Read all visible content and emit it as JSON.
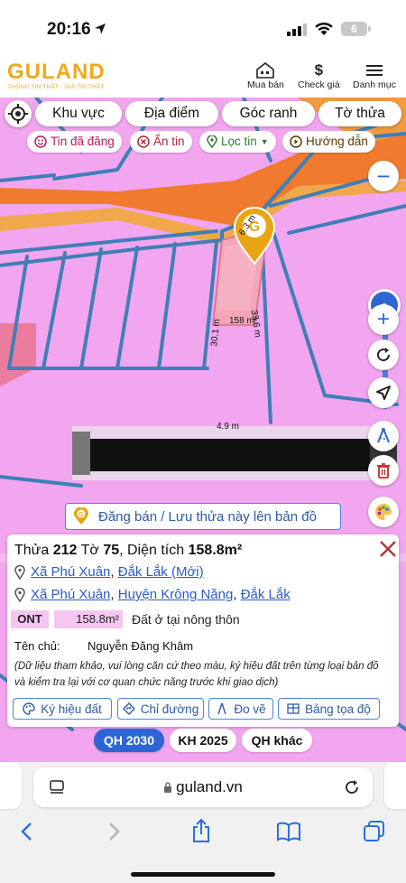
{
  "status": {
    "time": "20:16",
    "battery": "6"
  },
  "header": {
    "logo": "GULAND",
    "tagline": "THÔNG TIN THẬT - GIÁ TRỊ THẬT",
    "buy_sell": "Mua bán",
    "check_price": "Check giá",
    "menu": "Danh mục"
  },
  "top_nav": {
    "region": "Khu vực",
    "place": "Địa điểm",
    "boundary": "Góc ranh",
    "parcel": "Tờ thửa"
  },
  "filters": {
    "posted": "Tin đã đăng",
    "hide": "Ẩn tin",
    "filter": "Lọc tin",
    "guide": "Hướng dẫn"
  },
  "map": {
    "zoom_value": "0",
    "dims": {
      "top": "6.3 m",
      "left": "30.1 m",
      "right": "33.6 m",
      "bottom": "4.9 m",
      "area": "158 m²"
    },
    "post_banner": "Đăng bán / Lưu thửa này lên bản đồ"
  },
  "parcel": {
    "title_prefix": "Thửa",
    "parcel_no": "212",
    "sheet_label": "Tờ",
    "sheet_no": "75",
    "area_label": ", Diện tích",
    "area": "158.8m²",
    "address1": {
      "commune": "Xã Phú Xuân",
      "sep": ",",
      "province": "Đắk Lắk (Mới)"
    },
    "address2": {
      "commune": "Xã Phú Xuân",
      "district": "Huyện Krông Năng",
      "province": "Đắk Lắk"
    },
    "land_code": "ONT",
    "land_area": "158.8m²",
    "land_desc": "Đất ở tại nông thôn",
    "owner_label": "Tên chủ:",
    "owner_name": "Nguyễn Đăng Khâm",
    "note": "(Dữ liệu tham khảo, vui lòng căn cứ theo màu, ký hiệu đất trên từng loại bản đồ và kiểm tra lại với cơ quan chức năng trước khi giao dịch)",
    "actions": {
      "symbols": "Ký hiệu đất",
      "directions": "Chỉ đường",
      "measure": "Đo vẽ",
      "coords": "Bảng tọa độ"
    }
  },
  "plan_tabs": {
    "qh2030": "QH 2030",
    "kh2025": "KH 2025",
    "other": "QH khác"
  },
  "browser": {
    "url": "guland.vn"
  },
  "colors": {
    "map_pink": "#f2a6ef",
    "road_blue": "#3f7fb8",
    "accent_blue": "#2d66d4",
    "logo_gold": "#f0a81e",
    "close_red": "#b03535"
  }
}
